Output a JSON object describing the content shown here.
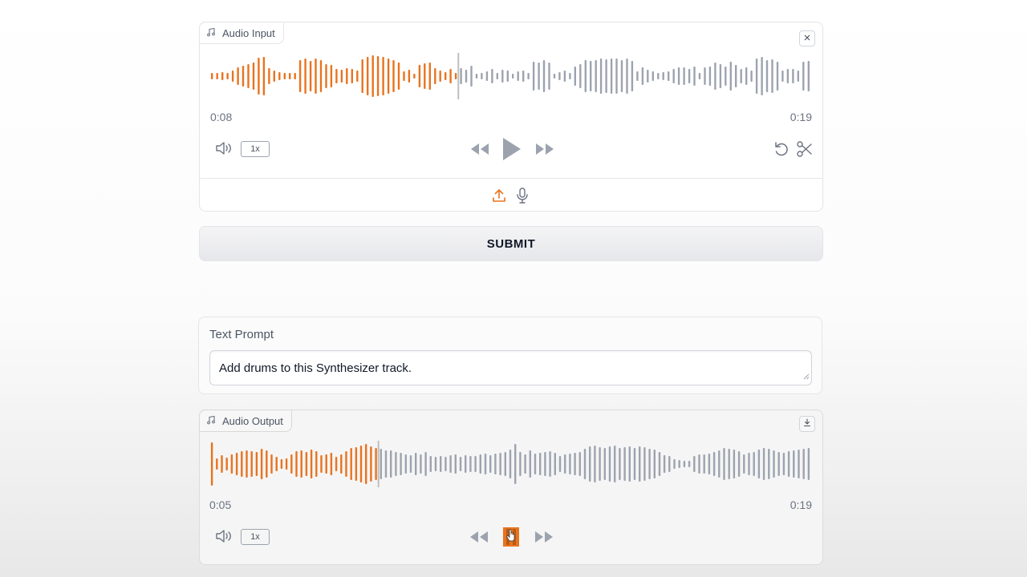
{
  "input": {
    "label": "Audio Input",
    "current_time": "0:08",
    "duration": "0:19",
    "speed": "1x",
    "progress": 0.41,
    "bars": [
      8,
      8,
      10,
      8,
      14,
      22,
      26,
      30,
      34,
      46,
      48,
      20,
      14,
      10,
      8,
      8,
      8,
      40,
      44,
      38,
      44,
      40,
      30,
      28,
      18,
      16,
      20,
      18,
      14,
      42,
      48,
      52,
      50,
      48,
      44,
      40,
      34,
      12,
      16,
      6,
      28,
      32,
      34,
      20,
      14,
      10,
      18,
      8,
      20,
      16,
      26,
      6,
      8,
      12,
      18,
      8,
      16,
      14,
      6,
      12,
      14,
      8,
      36,
      34,
      40,
      34,
      6,
      10,
      14,
      8,
      24,
      30,
      40,
      38,
      40,
      44,
      42,
      44,
      44,
      40,
      44,
      38,
      12,
      22,
      16,
      12,
      8,
      10,
      12,
      18,
      22,
      22,
      18,
      24,
      8,
      22,
      24,
      34,
      30,
      24,
      36,
      28,
      18,
      22,
      14,
      44,
      48,
      40,
      42,
      36,
      14,
      18,
      18,
      14,
      36,
      38
    ],
    "colors": {
      "played": "#e8731f",
      "unplayed": "#9ca3af",
      "cursor": "#bfbfbf"
    }
  },
  "submit": {
    "label": "SUBMIT"
  },
  "prompt": {
    "label": "Text Prompt",
    "value": "Add drums to this Synthesizer track."
  },
  "output": {
    "label": "Audio Output",
    "current_time": "0:05",
    "duration": "0:19",
    "speed": "1x",
    "progress": 0.285,
    "bars": [
      54,
      14,
      22,
      16,
      24,
      28,
      32,
      34,
      32,
      30,
      38,
      34,
      24,
      18,
      12,
      14,
      24,
      32,
      34,
      30,
      36,
      32,
      22,
      24,
      28,
      18,
      24,
      32,
      40,
      42,
      46,
      50,
      44,
      40,
      38,
      34,
      34,
      30,
      28,
      24,
      22,
      28,
      24,
      30,
      20,
      18,
      20,
      18,
      22,
      24,
      18,
      22,
      20,
      20,
      24,
      26,
      22,
      26,
      28,
      30,
      36,
      50,
      30,
      24,
      34,
      26,
      28,
      30,
      32,
      28,
      20,
      24,
      26,
      28,
      30,
      38,
      44,
      46,
      42,
      40,
      44,
      46,
      40,
      42,
      44,
      40,
      44,
      42,
      38,
      36,
      30,
      22,
      20,
      12,
      10,
      8,
      8,
      20,
      24,
      24,
      26,
      30,
      34,
      40,
      38,
      36,
      32,
      24,
      28,
      30,
      36,
      40,
      38,
      34,
      30,
      28,
      32,
      34,
      36,
      38,
      40
    ]
  }
}
